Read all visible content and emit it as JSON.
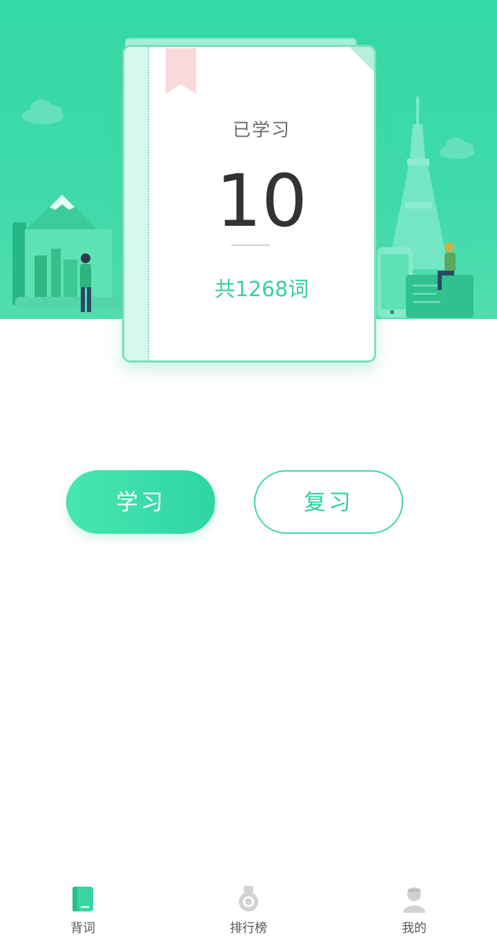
{
  "hero": {
    "learned_label": "已学习",
    "learned_count": "10",
    "total_words": "共1268词",
    "colors": {
      "hero_bg": "#34d9a5",
      "accent": "#3bcfa0",
      "bookmark": "#fbd9d9"
    }
  },
  "actions": {
    "study_label": "学习",
    "review_label": "复习"
  },
  "nav": {
    "items": [
      {
        "label": "背词",
        "icon": "book-icon",
        "active": true
      },
      {
        "label": "排行榜",
        "icon": "medal-icon",
        "active": false
      },
      {
        "label": "我的",
        "icon": "user-icon",
        "active": false
      }
    ]
  }
}
